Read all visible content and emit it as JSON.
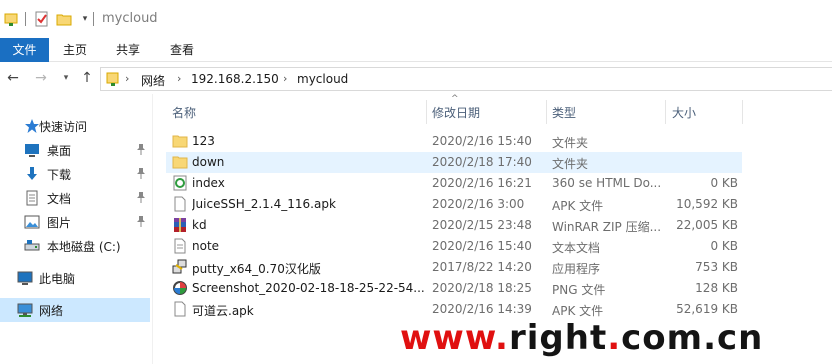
{
  "window": {
    "title": "mycloud"
  },
  "ribbon": {
    "tabs": [
      "文件",
      "主页",
      "共享",
      "查看"
    ]
  },
  "address": {
    "crumbs": [
      "网络",
      "192.168.2.150",
      "mycloud"
    ]
  },
  "sidebar": {
    "items": [
      {
        "label": "快速访问",
        "icon": "star-icon"
      },
      {
        "label": "桌面",
        "icon": "desktop-icon",
        "pinned": true
      },
      {
        "label": "下载",
        "icon": "download-icon",
        "pinned": true
      },
      {
        "label": "文档",
        "icon": "documents-icon",
        "pinned": true
      },
      {
        "label": "图片",
        "icon": "pictures-icon",
        "pinned": true
      },
      {
        "label": "本地磁盘 (C:)",
        "icon": "drive-icon"
      },
      {
        "label": "此电脑",
        "icon": "computer-icon"
      },
      {
        "label": "网络",
        "icon": "network-icon",
        "selected": true
      }
    ]
  },
  "columns": {
    "name": "名称",
    "date": "修改日期",
    "type": "类型",
    "size": "大小"
  },
  "files": [
    {
      "name": "123",
      "date": "2020/2/16 15:40",
      "type": "文件夹",
      "size": "",
      "icon": "folder-icon"
    },
    {
      "name": "down",
      "date": "2020/2/18 17:40",
      "type": "文件夹",
      "size": "",
      "icon": "folder-icon",
      "highlighted": true
    },
    {
      "name": "index",
      "date": "2020/2/16 16:21",
      "type": "360 se HTML Do...",
      "size": "0 KB",
      "icon": "html-file-icon"
    },
    {
      "name": "JuiceSSH_2.1.4_116.apk",
      "date": "2020/2/16 3:00",
      "type": "APK 文件",
      "size": "10,592 KB",
      "icon": "file-icon"
    },
    {
      "name": "kd",
      "date": "2020/2/15 23:48",
      "type": "WinRAR ZIP 压缩...",
      "size": "22,005 KB",
      "icon": "winrar-icon"
    },
    {
      "name": "note",
      "date": "2020/2/16 15:40",
      "type": "文本文档",
      "size": "0 KB",
      "icon": "text-file-icon"
    },
    {
      "name": "putty_x64_0.70汉化版",
      "date": "2017/8/22 14:20",
      "type": "应用程序",
      "size": "753 KB",
      "icon": "putty-icon"
    },
    {
      "name": "Screenshot_2020-02-18-18-25-22-54...",
      "date": "2020/2/18 18:25",
      "type": "PNG 文件",
      "size": "128 KB",
      "icon": "image-file-icon"
    },
    {
      "name": "可道云.apk",
      "date": "2020/2/16 14:39",
      "type": "APK 文件",
      "size": "52,619 KB",
      "icon": "file-icon"
    }
  ],
  "watermark": {
    "prefix": "www.",
    "middle": "right",
    "dot": ".",
    "suffix": "com.cn"
  },
  "colors": {
    "accent": "#1a6fc2",
    "selection": "#cce8ff",
    "hover": "#e5f3ff",
    "folder": "#f8d775",
    "watermark_red": "#e01010"
  }
}
